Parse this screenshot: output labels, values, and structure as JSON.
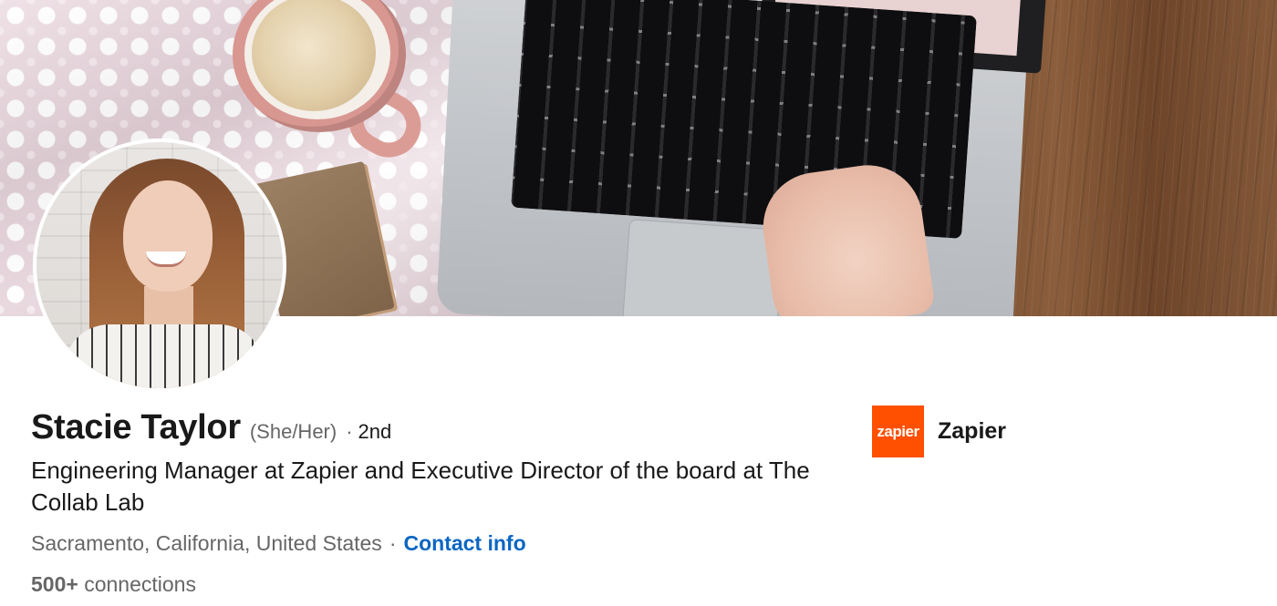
{
  "profile": {
    "name": "Stacie Taylor",
    "pronouns": "(She/Her)",
    "degree_separator": "·",
    "degree": "2nd",
    "headline": "Engineering Manager at Zapier and Executive Director of the board at The Collab Lab",
    "location": "Sacramento, California, United States",
    "location_separator": "·",
    "contact_info_label": "Contact info",
    "connections_count": "500+",
    "connections_label": "connections"
  },
  "current_company": {
    "logo_text": "zapier",
    "name": "Zapier",
    "brand_color": "#ff4f00"
  },
  "colors": {
    "link": "#0a66c2",
    "text_primary": "#191919",
    "text_secondary": "#666666"
  },
  "images": {
    "banner": "banner-photo",
    "avatar": "profile-photo"
  }
}
